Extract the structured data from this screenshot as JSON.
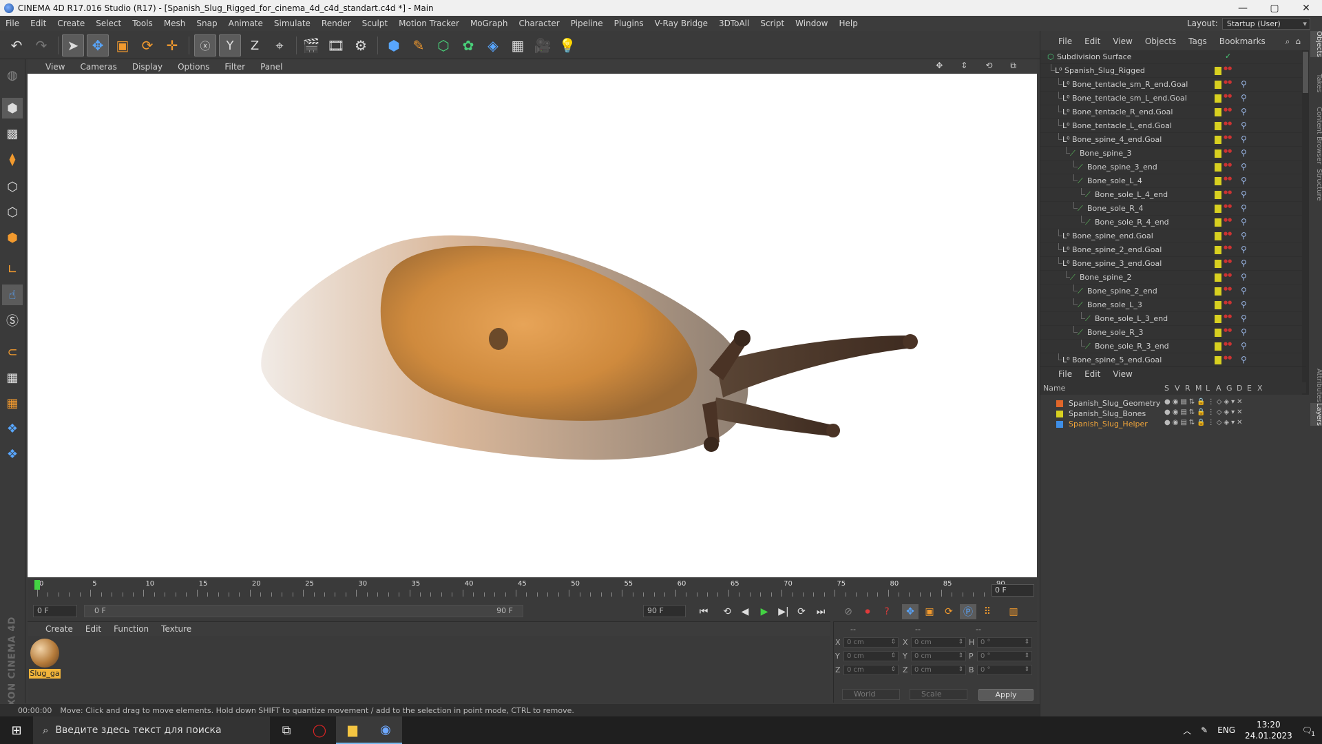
{
  "window": {
    "title": "CINEMA 4D R17.016 Studio (R17) - [Spanish_Slug_Rigged_for_cinema_4d_c4d_standart.c4d *] - Main",
    "minimize": "—",
    "maximize": "▢",
    "close": "✕"
  },
  "menubar": [
    "File",
    "Edit",
    "Create",
    "Select",
    "Tools",
    "Mesh",
    "Snap",
    "Animate",
    "Simulate",
    "Render",
    "Sculpt",
    "Motion Tracker",
    "MoGraph",
    "Character",
    "Pipeline",
    "Plugins",
    "V-Ray Bridge",
    "3DToAll",
    "Script",
    "Window",
    "Help"
  ],
  "layout": {
    "label": "Layout:",
    "value": "Startup (User)"
  },
  "toolbar": {
    "undo_icon": "undo-icon",
    "x_label": "X",
    "y_label": "Y",
    "z_label": "Z"
  },
  "viewport": {
    "menu": [
      "View",
      "Cameras",
      "Display",
      "Options",
      "Filter",
      "Panel"
    ]
  },
  "timeline": {
    "ticks": [
      "0",
      "5",
      "10",
      "15",
      "20",
      "25",
      "30",
      "35",
      "40",
      "45",
      "50",
      "55",
      "60",
      "65",
      "70",
      "75",
      "80",
      "85",
      "90"
    ],
    "current_frame": "0 F",
    "start_field": "0 F",
    "range_start": "0 F",
    "range_end": "90 F",
    "end_field": "90 F"
  },
  "material_panel": {
    "menu": [
      "Create",
      "Edit",
      "Function",
      "Texture"
    ],
    "material_name": "Slug_ga"
  },
  "coord_panel": {
    "header": [
      "--",
      "--",
      "--"
    ],
    "rows": [
      {
        "a": "X",
        "v1": "0 cm",
        "b": "X",
        "v2": "0 cm",
        "c": "H",
        "v3": "0 °"
      },
      {
        "a": "Y",
        "v1": "0 cm",
        "b": "Y",
        "v2": "0 cm",
        "c": "P",
        "v3": "0 °"
      },
      {
        "a": "Z",
        "v1": "0 cm",
        "b": "Z",
        "v2": "0 cm",
        "c": "B",
        "v3": "0 °"
      }
    ],
    "mode1": "World",
    "mode2": "Scale",
    "apply": "Apply"
  },
  "status": {
    "time": "00:00:00",
    "message": "Move: Click and drag to move elements. Hold down SHIFT to quantize movement / add to the selection in point mode, CTRL to remove."
  },
  "object_manager": {
    "menu": [
      "File",
      "Edit",
      "View",
      "Objects",
      "Tags",
      "Bookmarks"
    ],
    "objects": [
      {
        "name": "Subdivision Surface",
        "indent": 0,
        "type": "subd"
      },
      {
        "name": "Spanish_Slug_Rigged",
        "indent": 1,
        "type": "null"
      },
      {
        "name": "Bone_tentacle_sm_R_end.Goal",
        "indent": 2,
        "type": "null"
      },
      {
        "name": "Bone_tentacle_sm_L_end.Goal",
        "indent": 2,
        "type": "null"
      },
      {
        "name": "Bone_tentacle_R_end.Goal",
        "indent": 2,
        "type": "null"
      },
      {
        "name": "Bone_tentacle_L_end.Goal",
        "indent": 2,
        "type": "null"
      },
      {
        "name": "Bone_spine_4_end.Goal",
        "indent": 2,
        "type": "null"
      },
      {
        "name": "Bone_spine_3",
        "indent": 3,
        "type": "bone"
      },
      {
        "name": "Bone_spine_3_end",
        "indent": 4,
        "type": "bone"
      },
      {
        "name": "Bone_sole_L_4",
        "indent": 4,
        "type": "bone"
      },
      {
        "name": "Bone_sole_L_4_end",
        "indent": 5,
        "type": "bone"
      },
      {
        "name": "Bone_sole_R_4",
        "indent": 4,
        "type": "bone"
      },
      {
        "name": "Bone_sole_R_4_end",
        "indent": 5,
        "type": "bone"
      },
      {
        "name": "Bone_spine_end.Goal",
        "indent": 2,
        "type": "null"
      },
      {
        "name": "Bone_spine_2_end.Goal",
        "indent": 2,
        "type": "null"
      },
      {
        "name": "Bone_spine_3_end.Goal",
        "indent": 2,
        "type": "null"
      },
      {
        "name": "Bone_spine_2",
        "indent": 3,
        "type": "bone"
      },
      {
        "name": "Bone_spine_2_end",
        "indent": 4,
        "type": "bone"
      },
      {
        "name": "Bone_sole_L_3",
        "indent": 4,
        "type": "bone"
      },
      {
        "name": "Bone_sole_L_3_end",
        "indent": 5,
        "type": "bone"
      },
      {
        "name": "Bone_sole_R_3",
        "indent": 4,
        "type": "bone"
      },
      {
        "name": "Bone_sole_R_3_end",
        "indent": 5,
        "type": "bone"
      },
      {
        "name": "Bone_spine_5_end.Goal",
        "indent": 2,
        "type": "null"
      }
    ],
    "side_tabs": [
      "Objects",
      "Takes",
      "Content Browser",
      "Structure"
    ]
  },
  "layer_manager": {
    "menu": [
      "File",
      "Edit",
      "View"
    ],
    "columns": [
      "Name",
      "S",
      "V",
      "R",
      "M",
      "L",
      "A",
      "G",
      "D",
      "E",
      "X"
    ],
    "layers": [
      {
        "name": "Spanish_Slug_Geometry",
        "color": "#e0662a",
        "highlight": false
      },
      {
        "name": "Spanish_Slug_Bones",
        "color": "#d8d020",
        "highlight": false
      },
      {
        "name": "Spanish_Slug_Helper",
        "color": "#3e8ee6",
        "highlight": true
      }
    ],
    "side_tabs": [
      "Attributes",
      "Layers"
    ]
  },
  "taskbar": {
    "search_placeholder": "Введите здесь текст для поиска",
    "lang": "ENG",
    "time": "13:20",
    "date": "24.01.2023",
    "notification_count": "1"
  },
  "colors": {
    "accent_orange": "#f29a2e",
    "accent_blue": "#58a6ff",
    "bone_green": "#5ec45e",
    "layer_highlight": "#f1a53a"
  }
}
